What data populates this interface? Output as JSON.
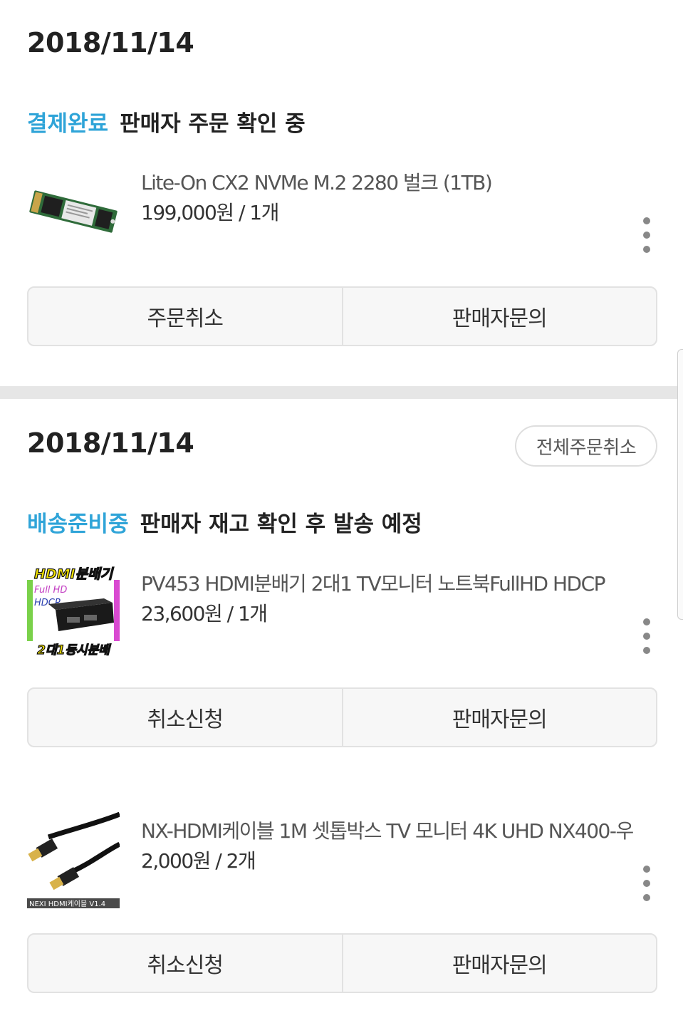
{
  "orders": [
    {
      "date": "2018/11/14",
      "status_label": "결제완료",
      "status_desc": "판매자 주문 확인 중",
      "items": [
        {
          "thumb_icon": "ssd-m2-image",
          "name": "Lite-On CX2 NVMe M.2 2280 벌크 (1TB)",
          "price": "199,000원 / 1개",
          "buttons": [
            "주문취소",
            "판매자문의"
          ]
        }
      ]
    },
    {
      "date": "2018/11/14",
      "cancel_all_label": "전체주문취소",
      "status_label": "배송준비중",
      "status_desc": "판매자 재고 확인 후 발송 예정",
      "items": [
        {
          "thumb_icon": "hdmi-splitter-image",
          "thumb_text": {
            "top": "HDMI분배기",
            "full": "Full HD",
            "hdcp": "HDCP",
            "bottom": "2대1동시분배"
          },
          "name": "PV453 HDMI분배기 2대1 TV모니터 노트북FullHD HDCP",
          "price": "23,600원 / 1개",
          "buttons": [
            "취소신청",
            "판매자문의"
          ]
        },
        {
          "thumb_icon": "hdmi-cable-image",
          "thumb_text": {
            "caption": "NEXI HDMI케이블 V1.4"
          },
          "name": "NX-HDMI케이블 1M 셋톱박스 TV 모니터 4K UHD NX400-우",
          "price": "2,000원 / 2개",
          "buttons": [
            "취소신청",
            "판매자문의"
          ]
        }
      ]
    }
  ],
  "colors": {
    "status_accent": "#2fa4d8",
    "section_divider": "#e6e6e6",
    "button_bg": "#f7f7f7"
  }
}
